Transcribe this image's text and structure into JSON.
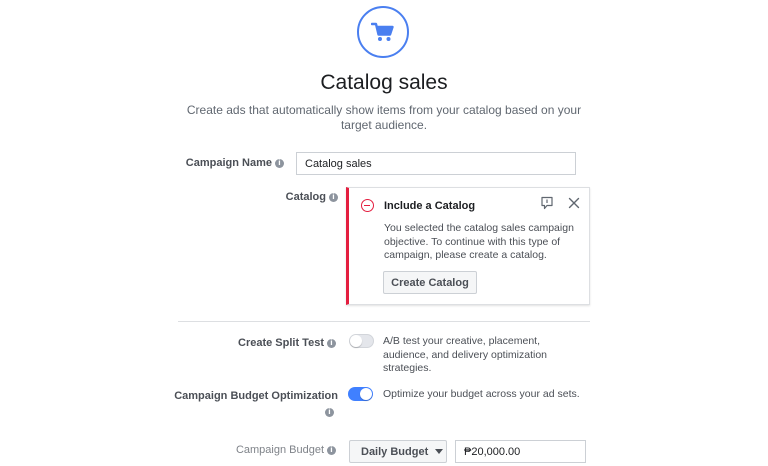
{
  "header": {
    "icon": "shopping-cart-icon",
    "title": "Catalog sales",
    "description": "Create ads that automatically show items from your catalog based on your target audience."
  },
  "campaign_name": {
    "label": "Campaign Name",
    "value": "Catalog sales"
  },
  "catalog": {
    "label": "Catalog",
    "alert": {
      "title": "Include a Catalog",
      "body": "You selected the catalog sales campaign objective. To continue with this type of campaign, please create a catalog.",
      "button_label": "Create Catalog"
    }
  },
  "split_test": {
    "label": "Create Split Test",
    "enabled": false,
    "helper": "A/B test your creative, placement, audience, and delivery optimization strategies."
  },
  "budget_optimization": {
    "label": "Campaign Budget Optimization",
    "enabled": true,
    "helper": "Optimize your budget across your ad sets."
  },
  "campaign_budget": {
    "label": "Campaign Budget",
    "type_selected": "Daily Budget",
    "amount": "₱20,000.00"
  },
  "colors": {
    "accent": "#4080ff",
    "error": "#e41e3f"
  }
}
